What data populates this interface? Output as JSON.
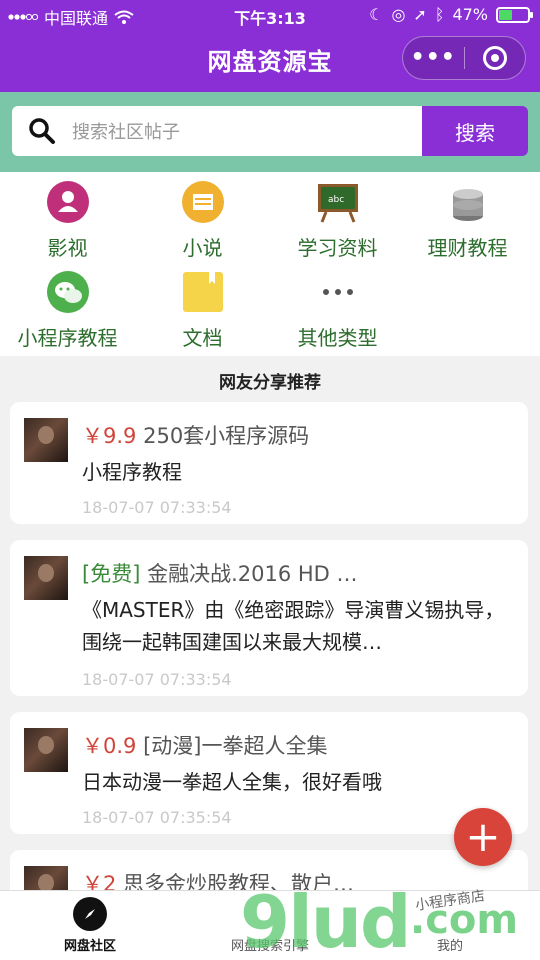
{
  "status_bar": {
    "carrier": "中国联通",
    "time": "下午3:13",
    "battery": "47%"
  },
  "nav": {
    "title": "网盘资源宝"
  },
  "search": {
    "placeholder": "搜索社区帖子",
    "button": "搜索"
  },
  "categories": [
    {
      "label": "影视",
      "icon": "person-icon",
      "color": "#c0307a"
    },
    {
      "label": "小说",
      "icon": "book-icon",
      "color": "#f0b030"
    },
    {
      "label": "学习资料",
      "icon": "chalkboard-icon",
      "color": "#3d7a2a"
    },
    {
      "label": "理财教程",
      "icon": "coins-icon",
      "color": "#888888"
    },
    {
      "label": "小程序教程",
      "icon": "chat-icon",
      "color": "#4db04d"
    },
    {
      "label": "文档",
      "icon": "folder-icon",
      "color": "#f5d44a"
    },
    {
      "label": "其他类型",
      "icon": "more-dots-icon",
      "color": "#555555"
    }
  ],
  "section_title": "网友分享推荐",
  "posts": [
    {
      "price": "￥9.9",
      "title": "250套小程序源码",
      "desc": "小程序教程",
      "time": "18-07-07 07:33:54"
    },
    {
      "tag": "[免费]",
      "title": "金融决战.2016 HD …",
      "desc": "《MASTER》由《绝密跟踪》导演曹义锡执导，围绕一起韩国建国以来最大规模…",
      "time": "18-07-07 07:33:54"
    },
    {
      "price": "￥0.9",
      "title": "[动漫]一拳超人全集",
      "desc": "日本动漫一拳超人全集，很好看哦",
      "time": "18-07-07 07:35:54"
    },
    {
      "price": "￥2",
      "title": "思多金炒股教程、散户…"
    }
  ],
  "tabs": [
    {
      "label": "网盘社区",
      "icon": "compass-icon"
    },
    {
      "label": "网盘搜索引擎"
    },
    {
      "label": "我的"
    }
  ],
  "watermark": {
    "logo": "9lud",
    "suffix": ".com",
    "sub": "小程序商店"
  },
  "colors": {
    "primary": "#8a2fd6",
    "search_bg": "#7bc5a8",
    "price": "#d0453a",
    "fab": "#d9443a"
  }
}
